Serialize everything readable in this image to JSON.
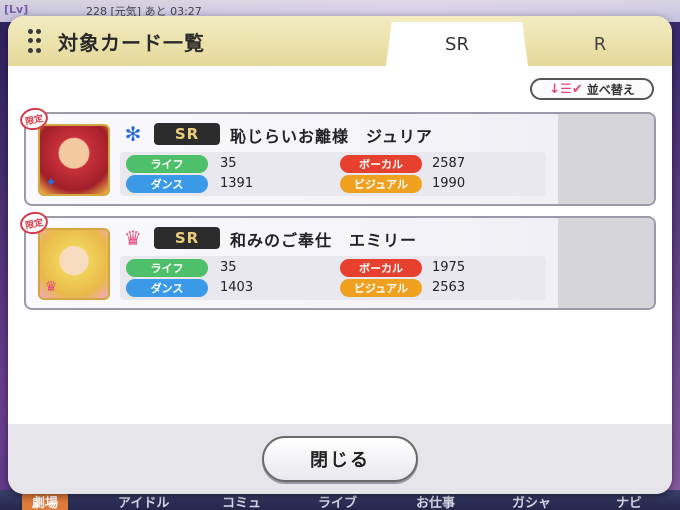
{
  "background": {
    "level_label": "[Lv]",
    "status_text": "228 [元気]  あと 03:27",
    "nav": [
      "劇場",
      "アイドル",
      "コミュ",
      "ライブ",
      "お仕事",
      "ガシャ",
      "ナビ"
    ]
  },
  "dialog": {
    "title": "対象カード一覧",
    "tabs": [
      {
        "label": "SR",
        "active": true
      },
      {
        "label": "R",
        "active": false
      }
    ],
    "sort_label": "並べ替え",
    "sort_icon": "↓☰✔",
    "cards": [
      {
        "limited_badge": "限定",
        "type_icon": "fairy-snowflake-icon",
        "type_glyph": "✻",
        "rarity": "SR",
        "name": "恥じらいお離様　ジュリア",
        "stats": {
          "life_label": "ライフ",
          "life": "35",
          "dance_label": "ダンス",
          "dance": "1391",
          "vocal_label": "ボーカル",
          "vocal": "2587",
          "visual_label": "ビジュアル",
          "visual": "1990"
        }
      },
      {
        "limited_badge": "限定",
        "type_icon": "princess-crown-icon",
        "type_glyph": "♛",
        "rarity": "SR",
        "name": "和みのご奉仕　エミリー",
        "stats": {
          "life_label": "ライフ",
          "life": "35",
          "dance_label": "ダンス",
          "dance": "1403",
          "vocal_label": "ボーカル",
          "vocal": "1975",
          "visual_label": "ビジュアル",
          "visual": "2563"
        }
      }
    ],
    "close_label": "閉じる"
  },
  "colors": {
    "life": "#4ec06a",
    "dance": "#3a9ae8",
    "vocal": "#e6402e",
    "visual": "#f0a020",
    "header": "#e4d999"
  }
}
